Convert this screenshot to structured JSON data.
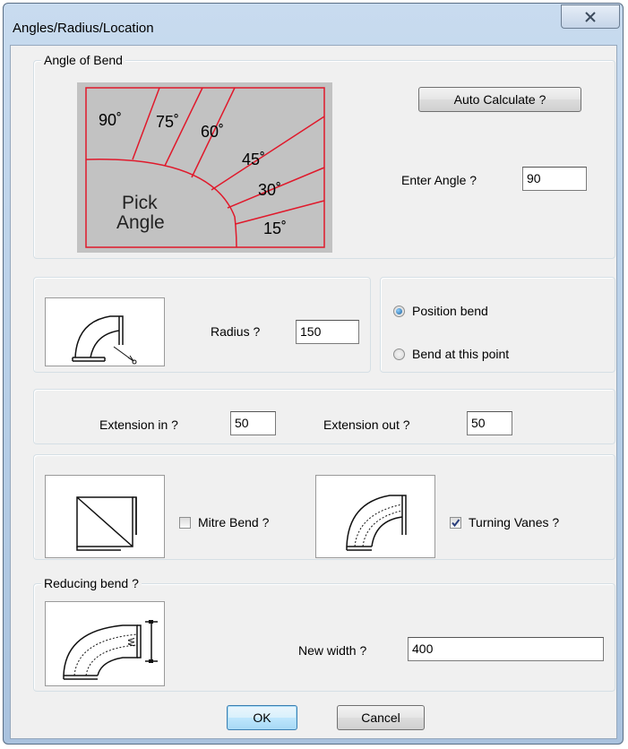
{
  "window": {
    "title": "Angles/Radius/Location"
  },
  "angle_group": {
    "legend": "Angle of Bend",
    "angle_labels": [
      "90˚",
      "75˚",
      "60˚",
      "45˚",
      "30˚",
      "15˚"
    ],
    "pick_line1": "Pick",
    "pick_line2": "Angle",
    "auto_calculate": "Auto Calculate ?",
    "enter_angle_label": "Enter Angle ?",
    "enter_angle_value": "90"
  },
  "radius_group": {
    "radius_label": "Radius ?",
    "radius_value": "150"
  },
  "position_group": {
    "position_bend": "Position bend",
    "bend_at_point": "Bend at this point",
    "selected": "position_bend"
  },
  "extension_group": {
    "ext_in_label": "Extension in ?",
    "ext_in_value": "50",
    "ext_out_label": "Extension out ?",
    "ext_out_value": "50"
  },
  "options_group": {
    "mitre_label": "Mitre Bend ?",
    "mitre_checked": false,
    "vanes_label": "Turning Vanes ?",
    "vanes_checked": true
  },
  "reducing_group": {
    "legend": "Reducing bend ?",
    "new_width_label": "New width ?",
    "new_width_value": "400",
    "w_mark": "W"
  },
  "buttons": {
    "ok": "OK",
    "cancel": "Cancel"
  },
  "colors": {
    "angle_lines": "#e0192b",
    "angle_bg": "#c2c2c2"
  }
}
